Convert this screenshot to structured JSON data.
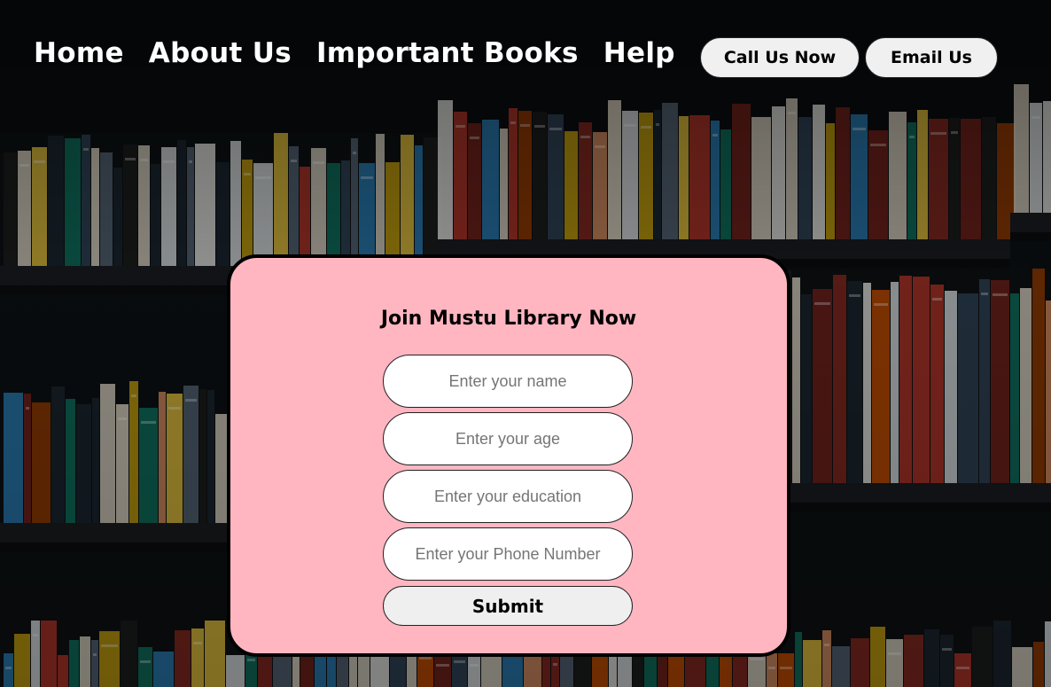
{
  "nav": {
    "items": [
      {
        "label": "Home"
      },
      {
        "label": "About Us"
      },
      {
        "label": "Important Books"
      },
      {
        "label": "Help"
      }
    ]
  },
  "actions": {
    "call_label": "Call Us Now",
    "email_label": "Email Us"
  },
  "form": {
    "title": "Join Mustu Library Now",
    "name_placeholder": "Enter your name",
    "age_placeholder": "Enter your age",
    "education_placeholder": "Enter your education",
    "phone_placeholder": "Enter your Phone Number",
    "submit_label": "Submit"
  },
  "colors": {
    "card_bg": "#ffb6c1",
    "card_border": "#000000",
    "button_bg": "#f0f0f0",
    "nav_text": "#ffffff"
  },
  "background": {
    "image": "library-bookshelf-photo"
  }
}
